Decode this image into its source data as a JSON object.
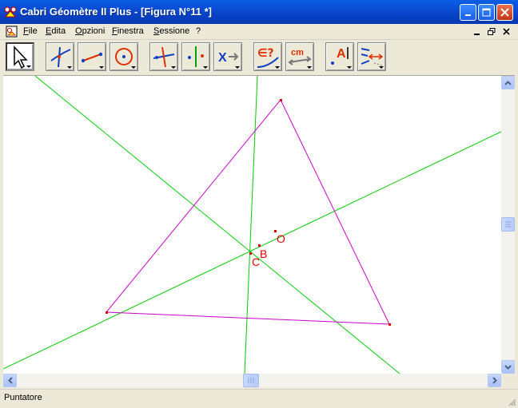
{
  "window": {
    "title": "Cabri Géomètre II Plus - [Figura N°11 *]",
    "title_color": "#ffffff",
    "accent": "#0842c8"
  },
  "menu": {
    "items": [
      "File",
      "Edita",
      "Opzioni",
      "Finestra",
      "Sessione",
      "?"
    ]
  },
  "toolbar": {
    "tools": [
      {
        "name": "pointer-tool",
        "icon": "arrow-pointer-icon"
      },
      {
        "name": "points-tool",
        "icon": "point-on-curve-icon"
      },
      {
        "name": "lines-tool",
        "icon": "segment-icon"
      },
      {
        "name": "curves-tool",
        "icon": "circle-icon"
      },
      {
        "name": "constructions-tool",
        "icon": "perpendicular-icon"
      },
      {
        "name": "transformations-tool",
        "icon": "symmetry-icon"
      },
      {
        "name": "macro-tool",
        "icon": "macro-icon"
      },
      {
        "name": "properties-tool",
        "icon": "membership-test-icon"
      },
      {
        "name": "measure-tool",
        "icon": "distance-icon"
      },
      {
        "name": "display-tool",
        "icon": "label-icon"
      },
      {
        "name": "drawing-tool",
        "icon": "aspect-icon"
      }
    ],
    "measure_label": "cm",
    "macro_label": "X",
    "membership_label": "∈?",
    "label_text": "A"
  },
  "figure": {
    "triangle_color": "#cc00cc",
    "lines_color": "#00cc00",
    "points_color": "#dd0000",
    "point_labels": [
      "B",
      "C",
      "O"
    ]
  },
  "statusbar": {
    "text": "Puntatore"
  }
}
